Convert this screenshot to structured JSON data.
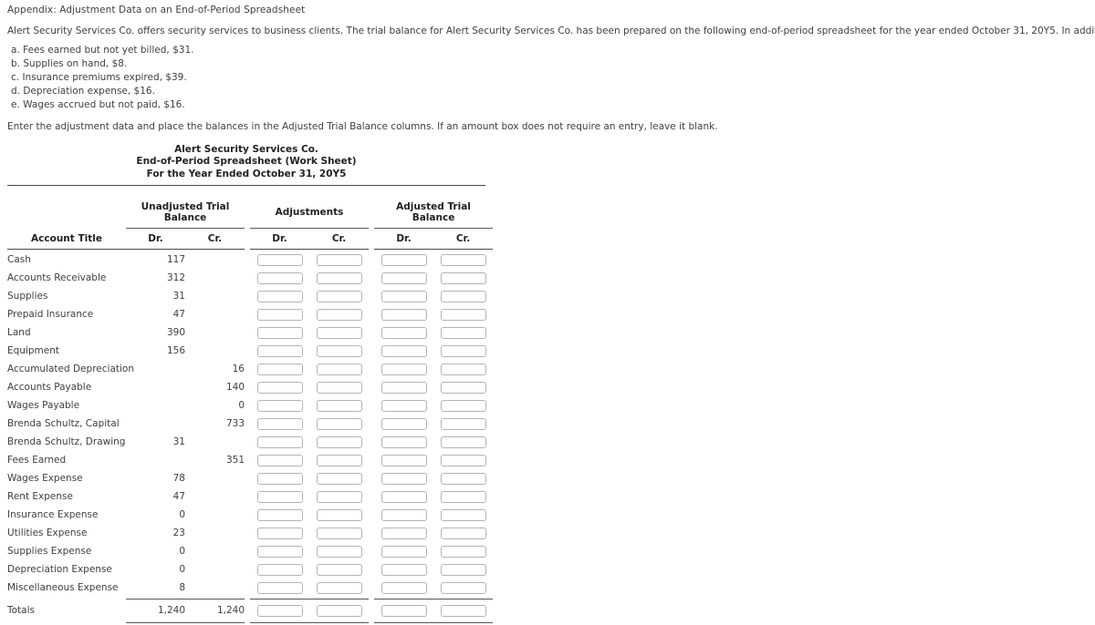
{
  "appendix_title": "Appendix: Adjustment Data on an End-of-Period Spreadsheet",
  "intro": "Alert Security Services Co. offers security services to business clients. The trial balance for Alert Security Services Co. has been prepared on the following end-of-period spreadsheet for the year ended October 31, 20Y5. In addition, the data for year-end adjustments are as follows:",
  "adjustments": [
    "a. Fees earned but not yet billed, $31.",
    "b. Supplies on hand, $8.",
    "c. Insurance premiums expired, $39.",
    "d. Depreciation expense, $16.",
    "e. Wages accrued but not paid, $16."
  ],
  "instruction": "Enter the adjustment data and place the balances in the Adjusted Trial Balance columns.  If an amount box does not require an entry, leave it blank.",
  "sheet": {
    "company": "Alert Security Services Co.",
    "subtitle": "End-of-Period Spreadsheet (Work Sheet)",
    "period": "For the Year Ended October 31, 20Y5",
    "groups": {
      "unadjusted": "Unadjusted Trial Balance",
      "adjustments": "Adjustments",
      "adjusted": "Adjusted Trial Balance"
    },
    "columns": {
      "account_title": "Account Title",
      "dr": "Dr.",
      "cr": "Cr."
    },
    "rows": [
      {
        "title": "Cash",
        "unadj_dr": "117",
        "unadj_cr": ""
      },
      {
        "title": "Accounts Receivable",
        "unadj_dr": "312",
        "unadj_cr": ""
      },
      {
        "title": "Supplies",
        "unadj_dr": "31",
        "unadj_cr": ""
      },
      {
        "title": "Prepaid Insurance",
        "unadj_dr": "47",
        "unadj_cr": ""
      },
      {
        "title": "Land",
        "unadj_dr": "390",
        "unadj_cr": ""
      },
      {
        "title": "Equipment",
        "unadj_dr": "156",
        "unadj_cr": ""
      },
      {
        "title": "Accumulated Depreciation",
        "unadj_dr": "",
        "unadj_cr": "16"
      },
      {
        "title": "Accounts Payable",
        "unadj_dr": "",
        "unadj_cr": "140"
      },
      {
        "title": "Wages Payable",
        "unadj_dr": "",
        "unadj_cr": "0"
      },
      {
        "title": "Brenda Schultz, Capital",
        "unadj_dr": "",
        "unadj_cr": "733"
      },
      {
        "title": "Brenda Schultz, Drawing",
        "unadj_dr": "31",
        "unadj_cr": ""
      },
      {
        "title": "Fees Earned",
        "unadj_dr": "",
        "unadj_cr": "351"
      },
      {
        "title": "Wages Expense",
        "unadj_dr": "78",
        "unadj_cr": ""
      },
      {
        "title": "Rent Expense",
        "unadj_dr": "47",
        "unadj_cr": ""
      },
      {
        "title": "Insurance Expense",
        "unadj_dr": "0",
        "unadj_cr": ""
      },
      {
        "title": "Utilities Expense",
        "unadj_dr": "23",
        "unadj_cr": ""
      },
      {
        "title": "Supplies Expense",
        "unadj_dr": "0",
        "unadj_cr": ""
      },
      {
        "title": "Depreciation Expense",
        "unadj_dr": "0",
        "unadj_cr": ""
      },
      {
        "title": "Miscellaneous Expense",
        "unadj_dr": "8",
        "unadj_cr": ""
      }
    ],
    "totals": {
      "title": "Totals",
      "unadj_dr": "1,240",
      "unadj_cr": "1,240"
    }
  }
}
